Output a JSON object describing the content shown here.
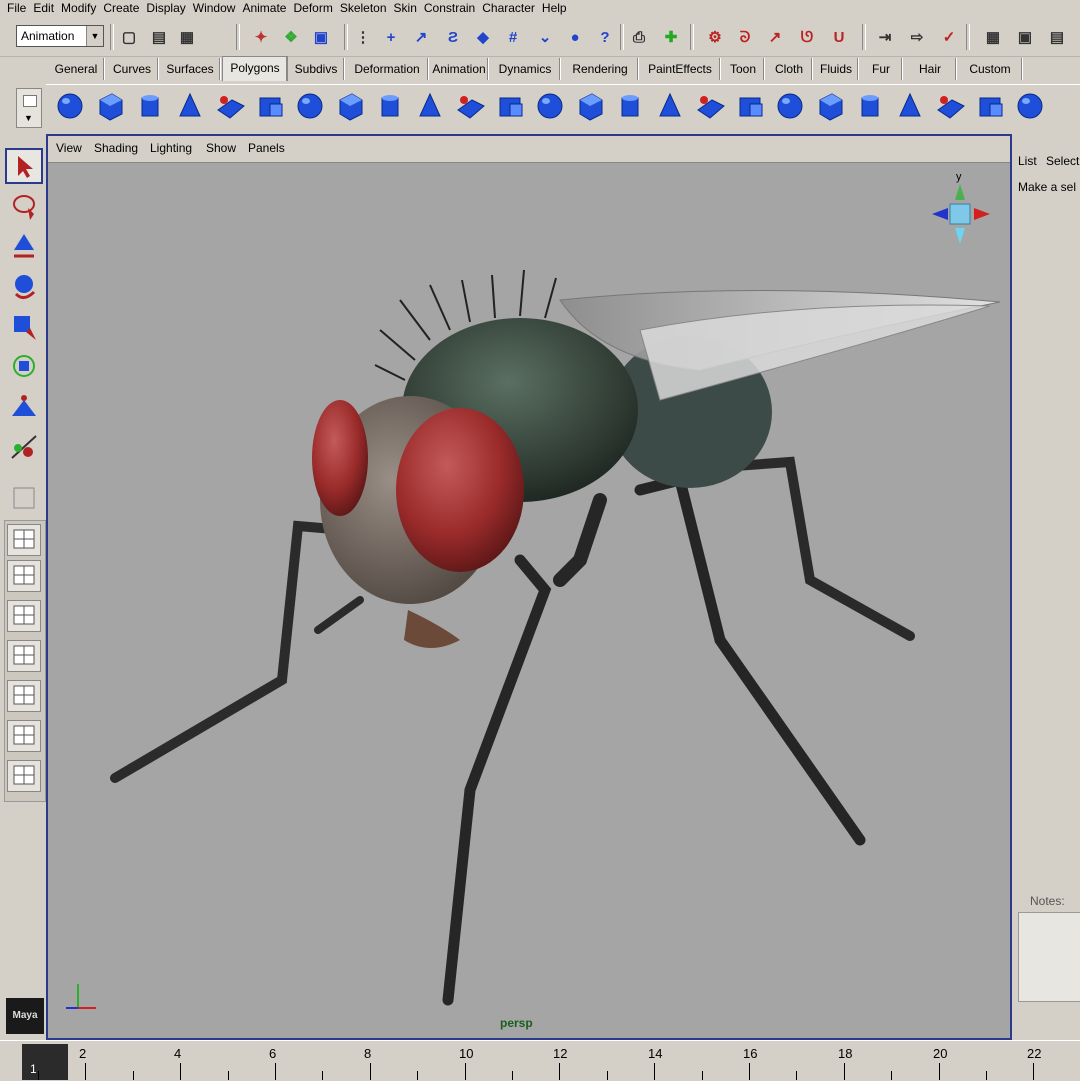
{
  "menu": [
    "File",
    "Edit",
    "Modify",
    "Create",
    "Display",
    "Window",
    "Animate",
    "Deform",
    "Skeleton",
    "Skin",
    "Constrain",
    "Character",
    "Help"
  ],
  "status_line": {
    "mode_value": "Animation"
  },
  "shelf_tabs": [
    "General",
    "Curves",
    "Surfaces",
    "Polygons",
    "Subdivs",
    "Deformation",
    "Animation",
    "Dynamics",
    "Rendering",
    "PaintEffects",
    "Toon",
    "Cloth",
    "Fluids",
    "Fur",
    "Hair",
    "Custom"
  ],
  "active_shelf_tab": "Polygons",
  "panel_menu": [
    "View",
    "Shading",
    "Lighting",
    "Show",
    "Panels"
  ],
  "viewport": {
    "camera": "persp",
    "view_cube_label": "y"
  },
  "right_panel": {
    "list_label": "List",
    "select_label": "Select",
    "hint": "Make a sel",
    "notes_label": "Notes:"
  },
  "timeline": {
    "labels": [
      "2",
      "4",
      "6",
      "8",
      "10",
      "12",
      "14",
      "16",
      "18",
      "20",
      "22"
    ],
    "current_frame": "1"
  },
  "colors": {
    "ui_gray": "#d4d0c8",
    "viewport_bg": "#a5a5a5",
    "viewport_border": "#2b3a8a",
    "shelf_blue": "#1f4fd8",
    "fly_eye": "#9b2b2b",
    "fly_body": "#2f3b33"
  }
}
